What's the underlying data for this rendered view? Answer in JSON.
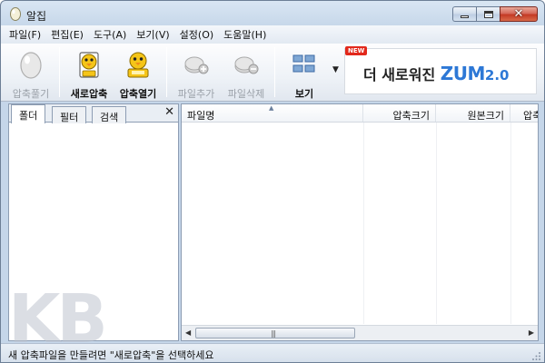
{
  "window": {
    "title": "알집",
    "close_glyph": "✕"
  },
  "menu": [
    {
      "label": "파일(F)"
    },
    {
      "label": "편집(E)"
    },
    {
      "label": "도구(A)"
    },
    {
      "label": "보기(V)"
    },
    {
      "label": "설정(O)"
    },
    {
      "label": "도움말(H)"
    }
  ],
  "toolbar": {
    "extract": "압축풀기",
    "new_archive": "새로압축",
    "open_archive": "압축열기",
    "add_file": "파일추가",
    "delete_file": "파일삭제",
    "view": "보기",
    "dropdown_glyph": "▼"
  },
  "banner": {
    "badge": "NEW",
    "text": "더 새로워진 ",
    "brand": "ZUM",
    "version": "2.0"
  },
  "left_pane": {
    "tabs": [
      "폴더",
      "필터",
      "검색"
    ],
    "close_glyph": "✕"
  },
  "file_list": {
    "columns": [
      "파일명",
      "압축크기",
      "원본크기",
      "압축"
    ],
    "scroll_grip": "|||",
    "scroll_left": "◀",
    "scroll_right": "▶"
  },
  "status": {
    "text": "새 압축파일을 만들려면 \"새로압축\"을 선택하세요"
  },
  "watermark": "KB",
  "colors": {
    "brand_blue": "#2d78d6",
    "new_badge_red": "#e2281b"
  }
}
